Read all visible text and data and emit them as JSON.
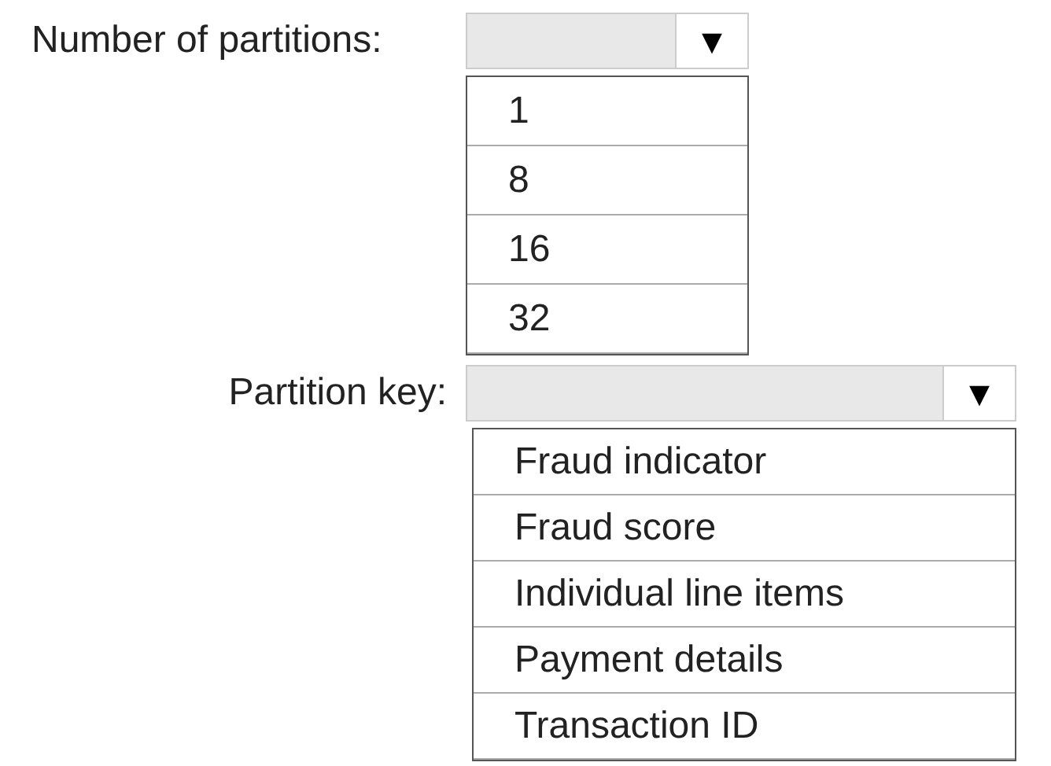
{
  "dropdowns": [
    {
      "label": "Number of partitions:",
      "arrow": "▼",
      "options": [
        "1",
        "8",
        "16",
        "32"
      ]
    },
    {
      "label": "Partition key:",
      "arrow": "▼",
      "options": [
        "Fraud indicator",
        "Fraud score",
        "Individual line items",
        "Payment details",
        "Transaction ID"
      ]
    }
  ]
}
